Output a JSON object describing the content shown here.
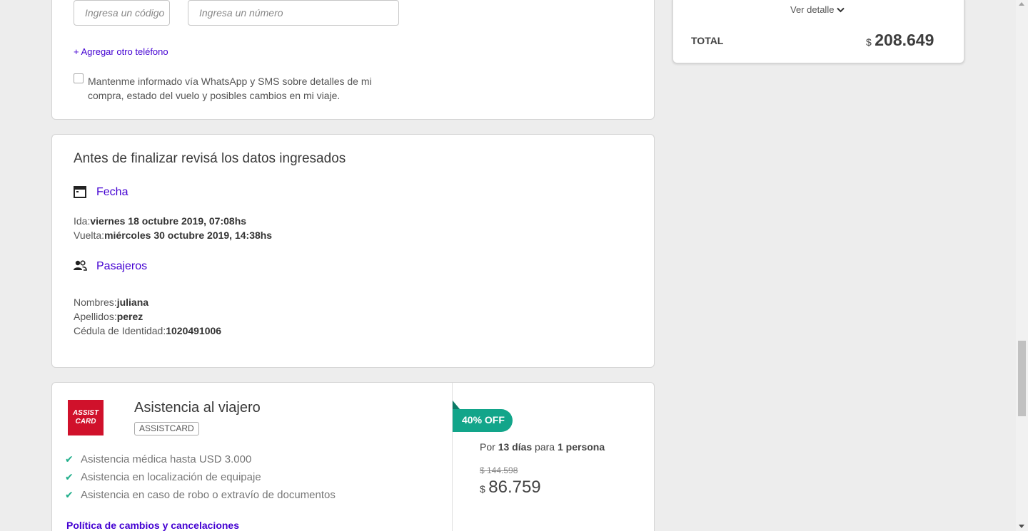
{
  "contact": {
    "area_placeholder": "Ingresa un código",
    "number_placeholder": "Ingresa un número",
    "add_phone_label": "+ Agregar otro teléfono",
    "whatsapp_line1": "Mantenme informado vía WhatsApp y SMS sobre detalles de mi",
    "whatsapp_line2": "compra, estado del vuelo y posibles cambios en mi viaje."
  },
  "review": {
    "title": "Antes de finalizar revisá los datos ingresados",
    "date_section": "Fecha",
    "ida_label": "Ida:",
    "ida_value": "viernes 18 octubre 2019, 07:08hs",
    "vuelta_label": "Vuelta:",
    "vuelta_value": "miércoles 30 octubre 2019, 14:38hs",
    "passengers_section": "Pasajeros",
    "nombres_label": "Nombres:",
    "nombres_value": "juliana",
    "apellidos_label": "Apellidos:",
    "apellidos_value": "perez",
    "cedula_label": "Cédula de Identidad:",
    "cedula_value": "1020491006"
  },
  "summary": {
    "detail_toggle": "Ver detalle",
    "total_label": "TOTAL",
    "currency": "$",
    "total_value": "208.649"
  },
  "assistance": {
    "logo_line1": "ASSIST",
    "logo_line2": "CARD",
    "title": "Asistencia al viajero",
    "provider_badge": "ASSISTCARD",
    "features": [
      "Asistencia médica hasta USD 3.000",
      "Asistencia en localización de equipaje",
      "Asistencia en caso de robo o extravío de documentos"
    ],
    "policy_link": "Política de cambios y cancelaciones",
    "discount_badge": "40% OFF",
    "duration_prefix": "Por ",
    "duration_days": "13 días",
    "duration_middle": " para ",
    "duration_people": "1 persona",
    "old_price": "$ 144.598",
    "currency": "$",
    "price": "86.759"
  },
  "colors": {
    "accent": "#4300d2",
    "discount": "#12a58a",
    "check": "#1fae8a",
    "logo_red": "#d0112b"
  }
}
